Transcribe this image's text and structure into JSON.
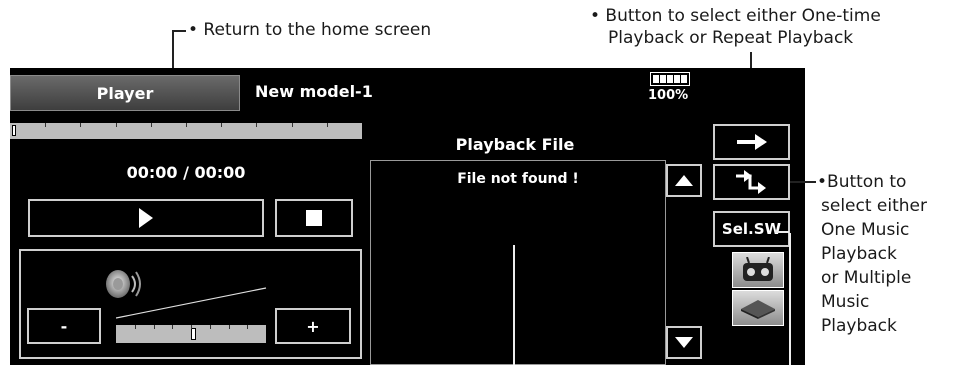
{
  "annotations": {
    "home": "• Return to the home screen",
    "repeat_line1": "• Button to select either One-time",
    "repeat_line2": "Playback or Repeat Playback",
    "sel_line1": "•Button to",
    "sel_line2": "select either",
    "sel_line3": "One Music",
    "sel_line4": "Playback",
    "sel_line5": "or Multiple",
    "sel_line6": "Music",
    "sel_line7": "Playback"
  },
  "header": {
    "tab_label": "Player",
    "model_name": "New model-1",
    "battery_percent": "100%"
  },
  "player": {
    "progress": 0.0,
    "time": "00:00 / 00:00",
    "vol_minus": "-",
    "vol_plus": "+",
    "volume_level": 0.52
  },
  "file_panel": {
    "title": "Playback File",
    "message": "File not found !"
  },
  "side": {
    "sel_sw_label": "Sel.SW"
  },
  "icons": {
    "repeat_mode": "right-arrow-icon",
    "music_mode": "shuffle-arrows-icon",
    "transmitter": "transmitter-icon",
    "memory": "memory-card-icon",
    "speaker": "speaker-icon"
  }
}
